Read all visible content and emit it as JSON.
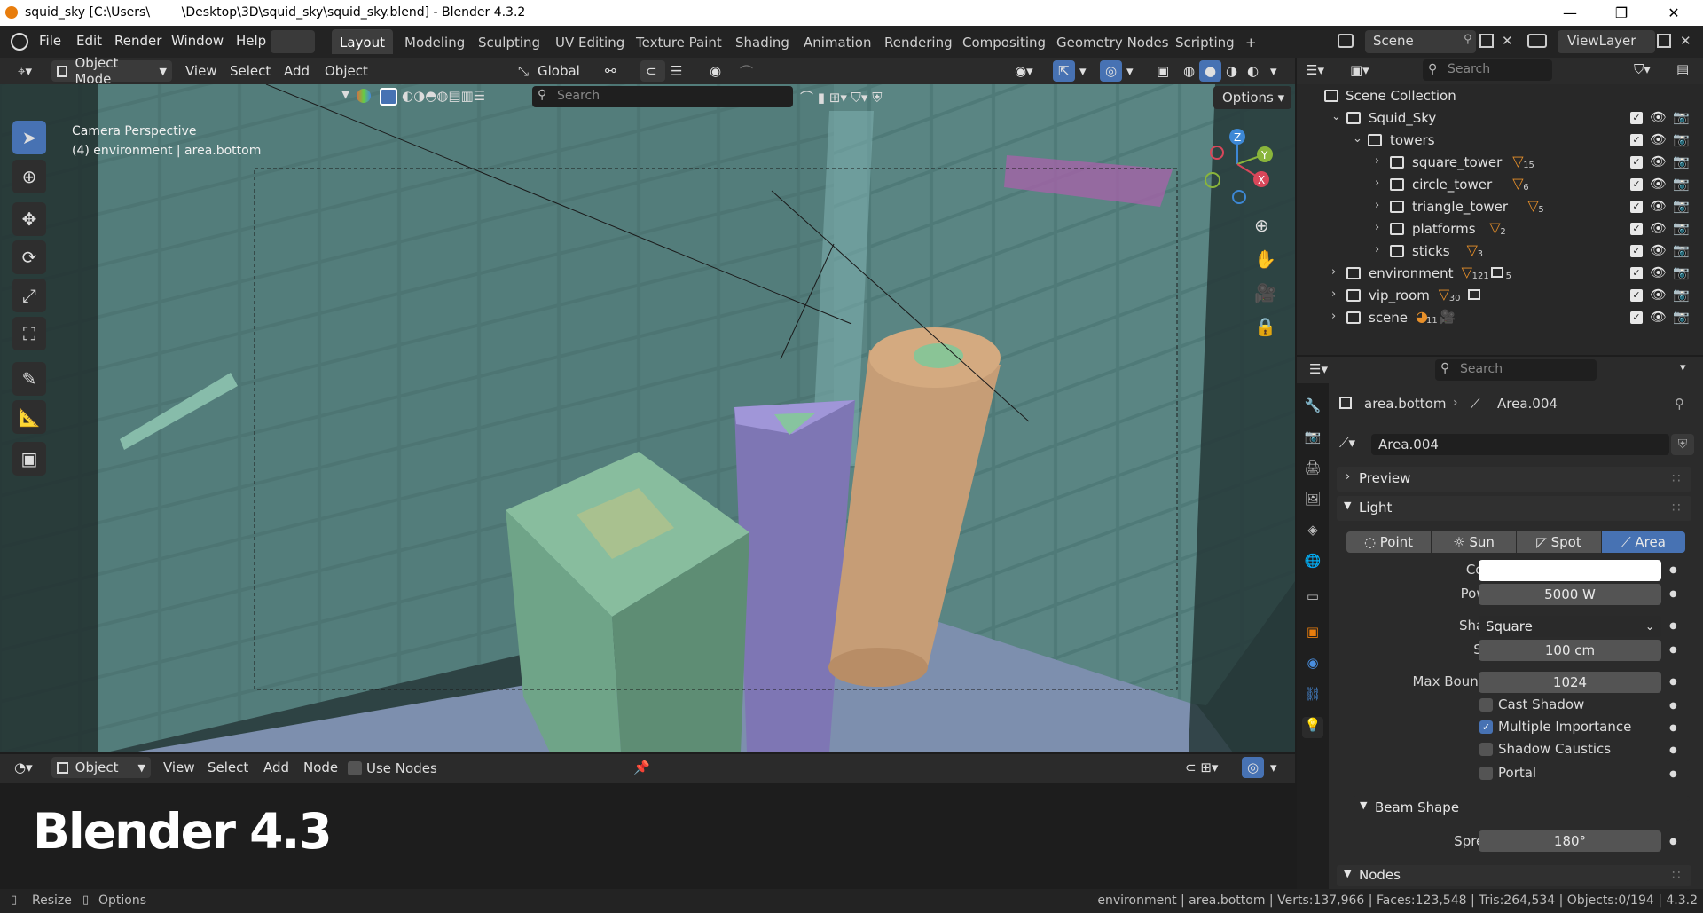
{
  "window": {
    "title": "squid_sky [C:\\Users\\        \\Desktop\\3D\\squid_sky\\squid_sky.blend] - Blender 4.3.2",
    "minimize": "—",
    "maximize": "❐",
    "close": "✕"
  },
  "menu": {
    "items": [
      "File",
      "Edit",
      "Render",
      "Window",
      "Help"
    ],
    "workspaces": [
      "Layout",
      "Modeling",
      "Sculpting",
      "UV Editing",
      "Texture Paint",
      "Shading",
      "Animation",
      "Rendering",
      "Compositing",
      "Geometry Nodes",
      "Scripting"
    ],
    "active_workspace": "Layout",
    "add_tab": "+",
    "scene_name": "Scene",
    "view_layer": "ViewLayer"
  },
  "viewport_header": {
    "mode": "Object Mode",
    "menus": [
      "View",
      "Select",
      "Add",
      "Object"
    ],
    "orientation": "Global",
    "search_placeholder": "Search",
    "options_label": "Options"
  },
  "viewport": {
    "camera_label": "Camera Perspective",
    "context_label": "(4) environment | area.bottom"
  },
  "node_editor": {
    "type": "Object",
    "menus": [
      "View",
      "Select",
      "Add",
      "Node"
    ],
    "use_nodes_label": "Use Nodes",
    "overlay_text": "Blender 4.3"
  },
  "outliner": {
    "search_placeholder": "Search",
    "root": "Scene Collection",
    "rows": [
      {
        "name": "Squid_Sky",
        "depth": 1,
        "badge": ""
      },
      {
        "name": "towers",
        "depth": 2,
        "badge": ""
      },
      {
        "name": "square_tower",
        "depth": 3,
        "badge": "15"
      },
      {
        "name": "circle_tower",
        "depth": 3,
        "badge": "6"
      },
      {
        "name": "triangle_tower",
        "depth": 3,
        "badge": "5"
      },
      {
        "name": "platforms",
        "depth": 3,
        "badge": "2"
      },
      {
        "name": "sticks",
        "depth": 3,
        "badge": "3"
      },
      {
        "name": "environment",
        "depth": 1,
        "badge": "121"
      },
      {
        "name": "vip_room",
        "depth": 1,
        "badge": "30"
      },
      {
        "name": "scene",
        "depth": 1,
        "badge": "11"
      }
    ],
    "environment_extra": "5"
  },
  "properties": {
    "search_placeholder": "Search",
    "breadcrumb_object": "area.bottom",
    "breadcrumb_data": "Area.004",
    "datablock_name": "Area.004",
    "panels": {
      "preview": "Preview",
      "light": "Light",
      "beam_shape": "Beam Shape",
      "nodes": "Nodes"
    },
    "light_types": [
      "Point",
      "Sun",
      "Spot",
      "Area"
    ],
    "active_light_type": "Area",
    "labels": {
      "color": "Color",
      "power": "Power",
      "shape": "Shape",
      "size": "Size",
      "max_bounces": "Max Bounces",
      "spread": "Spread"
    },
    "values": {
      "color": "#ffffff",
      "power": "5000 W",
      "shape": "Square",
      "size": "100 cm",
      "max_bounces": "1024",
      "spread": "180°"
    },
    "checkboxes": [
      {
        "label": "Cast Shadow",
        "checked": false
      },
      {
        "label": "Multiple Importance",
        "checked": true
      },
      {
        "label": "Shadow Caustics",
        "checked": false
      },
      {
        "label": "Portal",
        "checked": false
      }
    ]
  },
  "status": {
    "resize": "Resize",
    "options": "Options",
    "stats": "environment | area.bottom | Verts:137,966 | Faces:123,548 | Tris:264,534 | Objects:0/194 | 4.3.2"
  },
  "colors": {
    "accent": "#4772b3",
    "square_tower": "#6fa488",
    "triangle_tower": "#8a80c4",
    "circle_tower": "#c4a07c",
    "walls": "#4f7775",
    "gizmo_x": "#d8475a",
    "gizmo_y": "#8ab53b",
    "gizmo_z": "#3d88d6"
  }
}
